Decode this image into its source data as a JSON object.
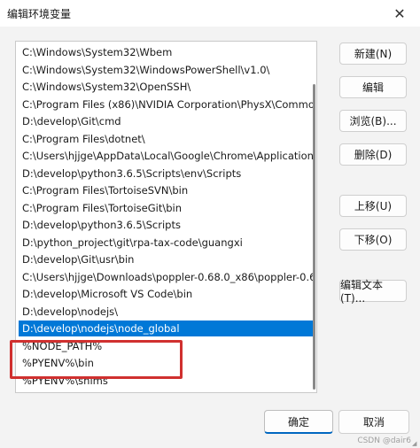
{
  "window": {
    "title": "编辑环境变量",
    "close_glyph": "✕"
  },
  "list": {
    "rows": [
      "C:\\Windows\\System32\\Wbem",
      "C:\\Windows\\System32\\WindowsPowerShell\\v1.0\\",
      "C:\\Windows\\System32\\OpenSSH\\",
      "C:\\Program Files (x86)\\NVIDIA Corporation\\PhysX\\Common",
      "D:\\develop\\Git\\cmd",
      "C:\\Program Files\\dotnet\\",
      "C:\\Users\\hjjge\\AppData\\Local\\Google\\Chrome\\Application\\",
      "D:\\develop\\python3.6.5\\Scripts\\env\\Scripts",
      "C:\\Program Files\\TortoiseSVN\\bin",
      "C:\\Program Files\\TortoiseGit\\bin",
      "D:\\develop\\python3.6.5\\Scripts",
      "D:\\python_project\\git\\rpa-tax-code\\guangxi",
      "D:\\develop\\Git\\usr\\bin",
      "C:\\Users\\hjjge\\Downloads\\poppler-0.68.0_x86\\poppler-0.68....",
      "D:\\develop\\Microsoft VS Code\\bin",
      "D:\\develop\\nodejs\\",
      "D:\\develop\\nodejs\\node_global",
      "%NODE_PATH%",
      "%PYENV%\\bin",
      "%PYENV%\\shims"
    ],
    "selected_index": 16
  },
  "buttons": {
    "new": "新建(N)",
    "edit": "编辑",
    "browse": "浏览(B)...",
    "delete": "删除(D)",
    "move_up": "上移(U)",
    "move_down": "下移(O)",
    "edit_text": "编辑文本(T)...",
    "ok": "确定",
    "cancel": "取消"
  },
  "watermark": "CSDN @dair6",
  "colors": {
    "selection": "#0078d7",
    "highlight_box": "#d0302f",
    "ok_accent": "#0067c0"
  }
}
